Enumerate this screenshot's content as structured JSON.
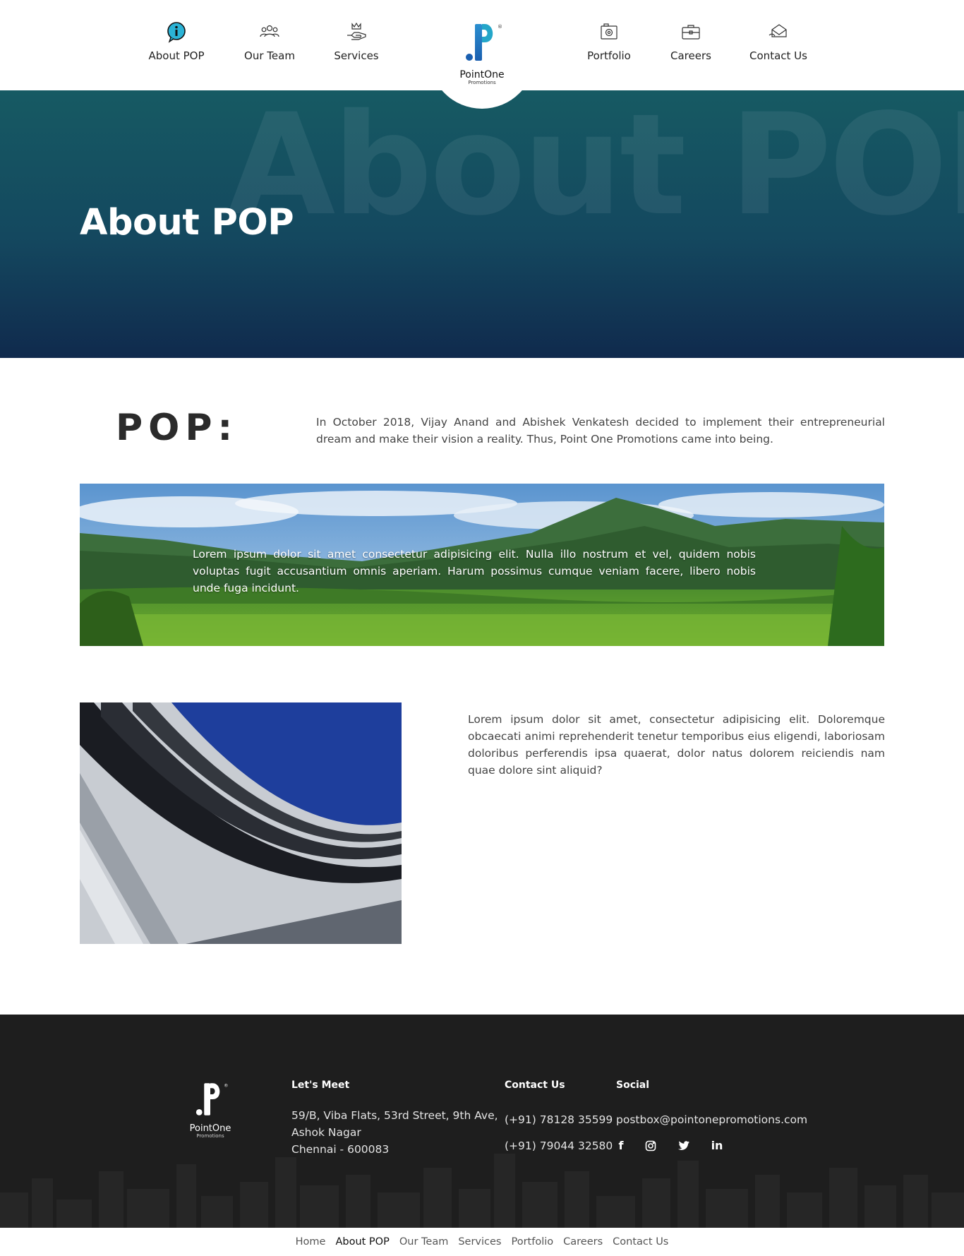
{
  "nav": {
    "items": [
      {
        "label": "About POP",
        "icon": "info-icon"
      },
      {
        "label": "Our Team",
        "icon": "team-icon"
      },
      {
        "label": "Services",
        "icon": "service-hand-icon"
      },
      {
        "label": "Portfolio",
        "icon": "portfolio-icon"
      },
      {
        "label": "Careers",
        "icon": "briefcase-icon"
      },
      {
        "label": "Contact Us",
        "icon": "contact-mail-icon"
      }
    ]
  },
  "logo": {
    "name": "PointOne",
    "sub": "Promotions",
    "mark": "®"
  },
  "hero": {
    "bg_text": "About POP",
    "title": "About POP"
  },
  "intro": {
    "heading": "POP:",
    "text": "In October 2018, Vijay Anand and Abishek Venkatesh decided to implement their entrepreneurial dream and make their vision a reality. Thus, Point One Promotions came into being."
  },
  "banner": {
    "text": "Lorem ipsum dolor sit amet consectetur adipisicing elit. Nulla illo nostrum et vel, quidem nobis voluptas fugit accusantium omnis aperiam. Harum possimus cumque veniam facere, libero nobis unde fuga incidunt."
  },
  "section2": {
    "text": "Lorem ipsum dolor sit amet, consectetur adipisicing elit. Doloremque obcaecati animi reprehenderit tenetur temporibus eius eligendi, laboriosam doloribus perferendis ipsa quaerat, dolor natus dolorem reiciendis nam quae dolore sint aliquid?"
  },
  "footer": {
    "lets_meet": {
      "title": "Let's Meet",
      "line1": "59/B, Viba Flats, 53rd Street, 9th Ave,",
      "line2": "Ashok Nagar",
      "line3": "Chennai - 600083"
    },
    "contact": {
      "title": "Contact Us",
      "phone1": "(+91) 78128 35599",
      "phone2": "(+91) 79044 32580"
    },
    "social": {
      "title": "Social",
      "email": "postbox@pointonepromotions.com",
      "icons": [
        "facebook-icon",
        "instagram-icon",
        "twitter-icon",
        "linkedin-icon"
      ]
    }
  },
  "bottom_nav": [
    "Home",
    "About POP",
    "Our Team",
    "Services",
    "Portfolio",
    "Careers",
    "Contact Us"
  ],
  "colors": {
    "brand_blue": "#1d6fb8",
    "brand_teal": "#24a6c9",
    "hero_top": "#165a63",
    "hero_bottom": "#102a4d",
    "footer_bg": "#1e1e1e"
  }
}
